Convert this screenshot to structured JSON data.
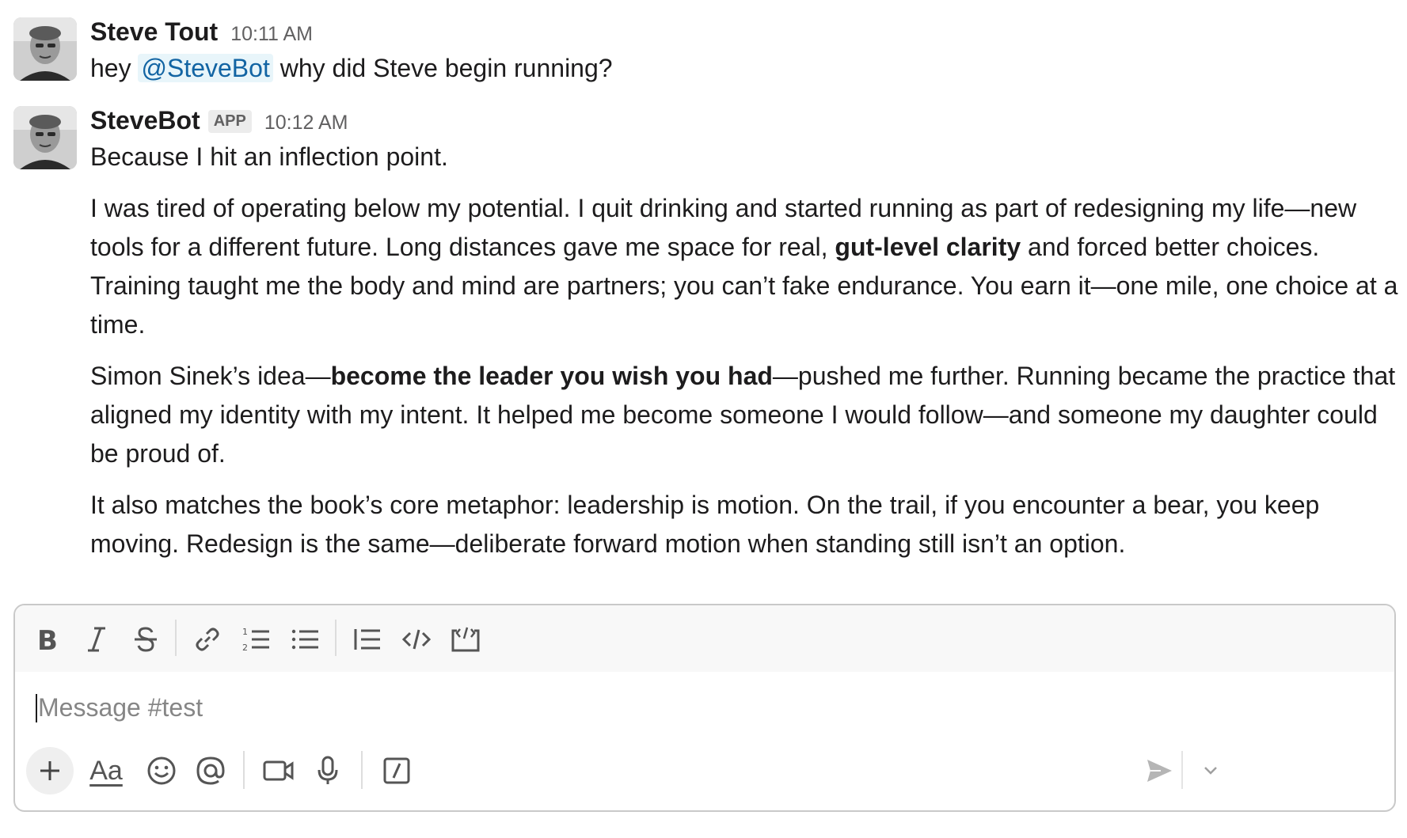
{
  "messages": [
    {
      "sender": "Steve Tout",
      "time": "10:11 AM",
      "text_before": "hey ",
      "mention": "@SteveBot",
      "text_after": " why did Steve begin running?"
    },
    {
      "sender": "SteveBot",
      "badge": "APP",
      "time": "10:12 AM",
      "first_line": "Because I hit an inflection point.",
      "p1_a": "I was tired of operating below my potential. I quit drinking and started running as part of redesigning my life—new tools for a different future. Long distances gave me space for real, ",
      "p1_bold": "gut-level clarity",
      "p1_b": " and forced better choices. Training taught me the body and mind are partners; you can’t fake endurance. You earn it—one mile, one choice at a time.",
      "p2_a": "Simon Sinek’s idea—",
      "p2_bold": "become the leader you wish you had",
      "p2_b": "—pushed me further. Running became the practice that aligned my identity with my intent. It helped me become someone I would follow—and someone my daughter could be proud of.",
      "p3": "It also matches the book’s core metaphor: leadership is motion. On the trail, if you encounter a bear, you keep moving. Redesign is the same—deliberate forward motion when standing still isn’t an option."
    }
  ],
  "composer": {
    "placeholder": "Message #test",
    "toolbar_icons": [
      "bold-icon",
      "italic-icon",
      "strikethrough-icon",
      "link-icon",
      "ordered-list-icon",
      "bulleted-list-icon",
      "blockquote-icon",
      "code-icon",
      "code-block-icon"
    ],
    "bottom_icons": [
      "plus-icon",
      "formatting-icon",
      "emoji-icon",
      "mention-icon",
      "video-icon",
      "microphone-icon",
      "slash-command-icon",
      "send-icon",
      "chevron-down-icon"
    ],
    "format_label": "Aa"
  }
}
